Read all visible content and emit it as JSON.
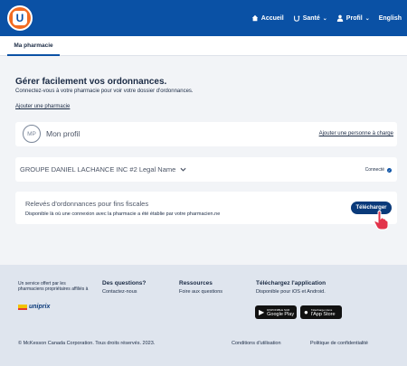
{
  "header": {
    "logo": "U",
    "nav": [
      {
        "label": "Accueil",
        "icon": "home-icon"
      },
      {
        "label": "Santé",
        "icon": "health-icon"
      },
      {
        "label": "Profil",
        "icon": "user-icon"
      },
      {
        "label": "English"
      }
    ]
  },
  "subnav": {
    "tab_label": "Ma pharmacie"
  },
  "intro": {
    "title": "Gérer facilement vos ordonnances.",
    "description": "Connectez-vous à votre pharmacie pour voir votre dossier d'ordonnances.",
    "add_link": "Ajouter une pharmacie"
  },
  "profile_card": {
    "initials": "MP",
    "label": "Mon profil",
    "add_person": "Ajouter une personne à charge"
  },
  "pharmacy_card": {
    "name": "GROUPE DANIEL LACHANCE INC #2 Legal Name",
    "status": "Connecté"
  },
  "tax_card": {
    "title": "Relevés d'ordonnances pour fins fiscales",
    "description": "Disponible là où une connexion avec la pharmacie a été établie par votre pharmacien.ne",
    "button": "Télécharger"
  },
  "footer": {
    "tagline": "Un service offert par les pharmaciens propriétaires affiliés à",
    "brand": "uniprix",
    "questions_title": "Des questions?",
    "questions_link": "Contactez-nous",
    "resources_title": "Ressources",
    "resources_link": "Foire aux questions",
    "download_title": "Téléchargez l'application",
    "download_desc": "Disponible pour iOS et Android.",
    "google_small": "DISPONIBLE SUR",
    "google_big": "Google Play",
    "apple_small": "Télécharger dans",
    "apple_big": "l'App Store",
    "copyright": "© McKesson Canada Corporation. Tous droits réservés. 2023.",
    "terms": "Conditions d'utilisation",
    "privacy": "Politique de confidentialité"
  },
  "colors": {
    "brand_blue": "#0a51a5",
    "button_navy": "#0a3a7a",
    "logo_orange": "#f26b21",
    "cursor_red": "#e2334a"
  }
}
